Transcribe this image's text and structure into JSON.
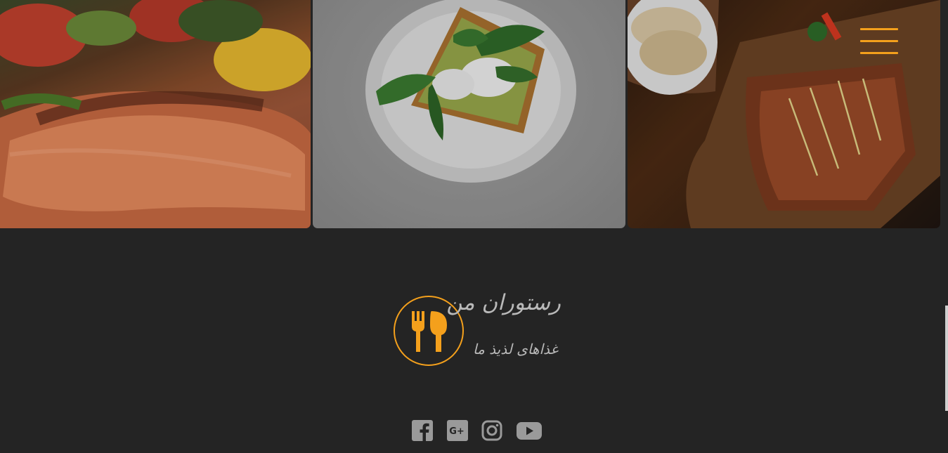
{
  "header": {
    "menu_icon": "hamburger-menu-icon",
    "accent_color": "#f4a01c"
  },
  "gallery": {
    "tiles": [
      {
        "subject": "salmon"
      },
      {
        "subject": "avocado-toast"
      },
      {
        "subject": "grilled-steak"
      }
    ]
  },
  "footer": {
    "background": "#242424",
    "text_color": "#b9b9b9",
    "brand_name": "رستوران من",
    "tagline": "غذاهای لذیذ ما",
    "logo_icon": "fork-spoon-icon",
    "social": [
      {
        "name": "facebook",
        "icon": "facebook-icon"
      },
      {
        "name": "google-plus",
        "icon": "google-plus-icon"
      },
      {
        "name": "instagram",
        "icon": "instagram-icon"
      },
      {
        "name": "youtube",
        "icon": "youtube-icon"
      }
    ]
  }
}
